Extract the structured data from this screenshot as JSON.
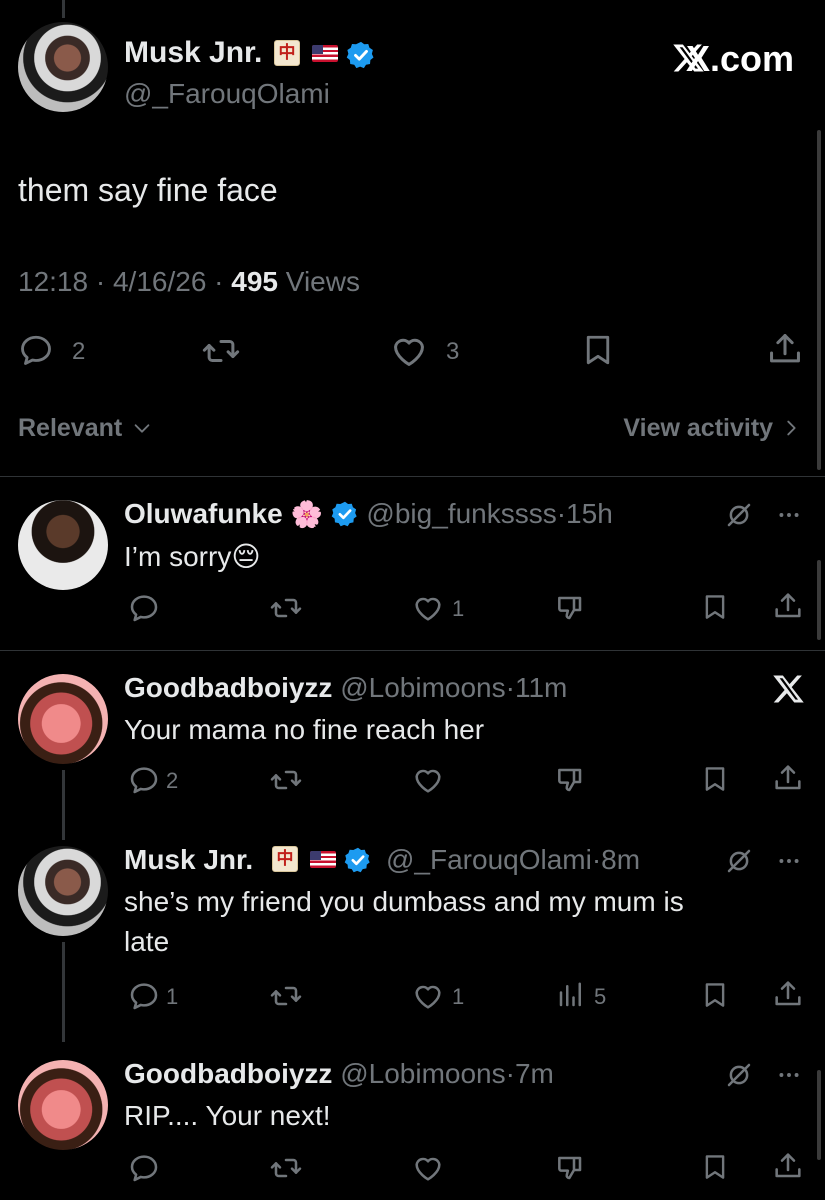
{
  "main_post": {
    "author_name": "Musk Jnr.",
    "badge_char": "中",
    "handle": "@_FarouqOlami",
    "brand": "X.com",
    "text": "them say fine face",
    "time": "12:18",
    "date": "4/16/26",
    "views_count": "495",
    "views_label": "Views",
    "replies": "2",
    "likes": "3"
  },
  "sort": {
    "label": "Relevant",
    "activity_link": "View activity"
  },
  "replies": [
    {
      "name": "Oluwafunke",
      "emoji": "🌸",
      "handle": "@big_funkssss",
      "time": "15h",
      "text": "I’m sorry😔",
      "reply_count": "",
      "like_count": "1",
      "view_count": ""
    },
    {
      "name": "Goodbadboiyzz",
      "handle": "@Lobimoons",
      "time": "11m",
      "text": "Your mama no fine reach her",
      "reply_count": "2",
      "like_count": "",
      "view_count": ""
    },
    {
      "name": "Musk Jnr.",
      "badge_char": "中",
      "handle": "@_FarouqOlami",
      "time": "8m",
      "text_line1": "she’s my friend you dumbass and my mum is",
      "text_line2": "late",
      "reply_count": "1",
      "like_count": "1",
      "view_count": "5"
    },
    {
      "name": "Goodbadboiyzz",
      "handle": "@Lobimoons",
      "time": "7m",
      "text": "RIP.... Your next!",
      "reply_count": "",
      "like_count": "",
      "view_count": ""
    }
  ],
  "colors": {
    "background": "#000000",
    "text": "#e7e9ea",
    "muted": "#71767b",
    "verified": "#1d9bf0",
    "divider": "#2f3336"
  },
  "separator": "·"
}
